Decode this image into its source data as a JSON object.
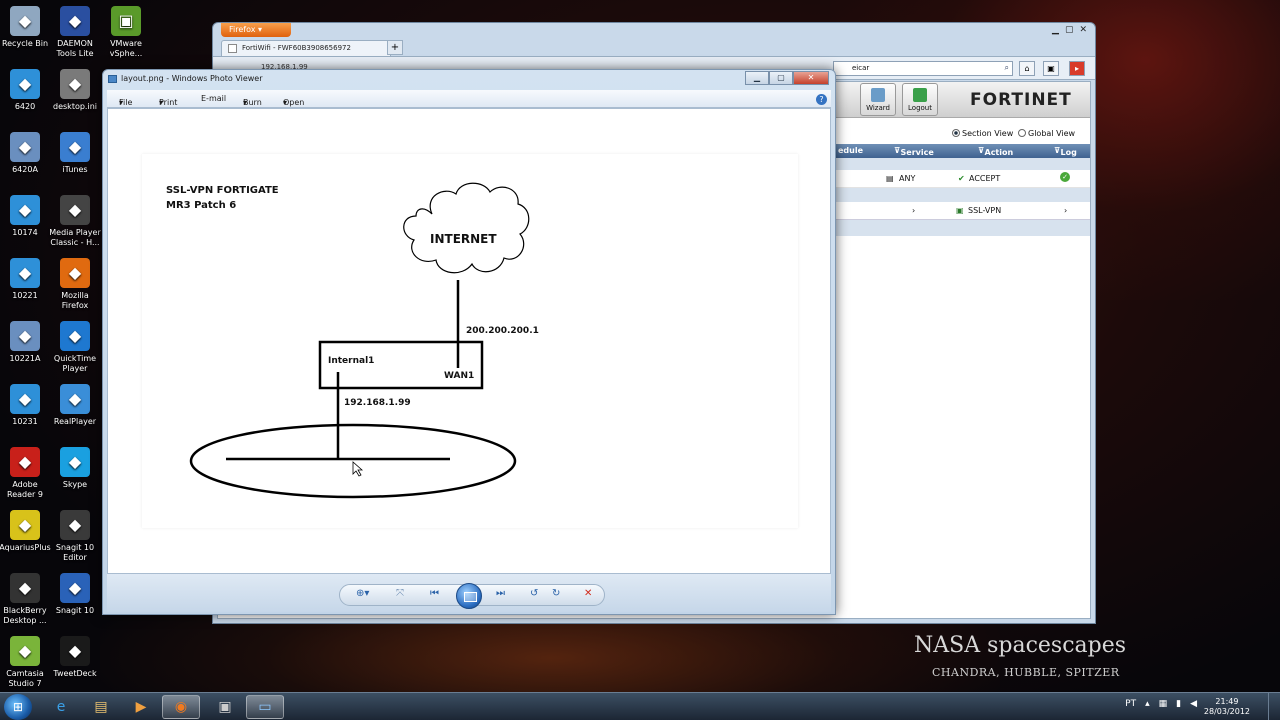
{
  "desktop": {
    "icons_col1": [
      {
        "label": "Recycle Bin",
        "icon": "recycle-bin-icon",
        "color": "#8fa7c0"
      },
      {
        "label": "6420",
        "icon": "vm-icon",
        "color": "#2e90d8"
      },
      {
        "label": "6420A",
        "icon": "vm-icon",
        "color": "#6a8fbf"
      },
      {
        "label": "10174",
        "icon": "vm-icon",
        "color": "#2e90d8"
      },
      {
        "label": "10221",
        "icon": "vm-icon",
        "color": "#2e90d8"
      },
      {
        "label": "10221A",
        "icon": "vm-icon",
        "color": "#6a8fbf"
      },
      {
        "label": "10231",
        "icon": "vm-icon",
        "color": "#2e90d8"
      },
      {
        "label": "Adobe Reader 9",
        "icon": "pdf-icon",
        "color": "#c8201a"
      },
      {
        "label": "AquariusPlus",
        "icon": "aquarius-icon",
        "color": "#d8c21a"
      },
      {
        "label": "BlackBerry Desktop ...",
        "icon": "blackberry-icon",
        "color": "#333333"
      },
      {
        "label": "Camtasia Studio 7",
        "icon": "camtasia-icon",
        "color": "#7ab43a"
      }
    ],
    "icons_col2": [
      {
        "label": "DAEMON Tools Lite",
        "icon": "daemon-tools-icon",
        "color": "#2a4fa0"
      },
      {
        "label": "desktop.ini",
        "icon": "file-icon",
        "color": "#7a7a7a"
      },
      {
        "label": "iTunes",
        "icon": "itunes-icon",
        "color": "#3a7ed0"
      },
      {
        "label": "Media Player Classic - H...",
        "icon": "media-player-icon",
        "color": "#444444"
      },
      {
        "label": "Mozilla Firefox",
        "icon": "firefox-icon",
        "color": "#e06a10"
      },
      {
        "label": "QuickTime Player",
        "icon": "quicktime-icon",
        "color": "#1e78d0"
      },
      {
        "label": "RealPlayer",
        "icon": "realplayer-icon",
        "color": "#3a8ed8"
      },
      {
        "label": "Skype",
        "icon": "skype-icon",
        "color": "#1aa0e0"
      },
      {
        "label": "Snagit 10 Editor",
        "icon": "snagit-editor-icon",
        "color": "#3a3a3a"
      },
      {
        "label": "Snagit 10",
        "icon": "snagit-icon",
        "color": "#2a62b8"
      },
      {
        "label": "TweetDeck",
        "icon": "tweetdeck-icon",
        "color": "#1a1a1a"
      }
    ],
    "icon_col3": {
      "label": "VMware vSphe...",
      "icon": "vmware-icon",
      "color": "#5a9a2a"
    },
    "brand_title": "NASA spacescapes",
    "brand_subtitle": "CHANDRA, HUBBLE, SPITZER"
  },
  "firefox": {
    "menu_label": "Firefox",
    "tab_title": "FortiWifi - FWF60B3908656972",
    "new_tab": "+",
    "url": "192.168.1.99",
    "search_value": "eicar",
    "toolbar_buttons": [
      {
        "label": "Wizard",
        "icon": "wizard-icon"
      },
      {
        "label": "Logout",
        "icon": "logout-icon"
      }
    ],
    "logo": "FORTINET",
    "view_options": [
      "Section View",
      "Global View"
    ],
    "table_headers": [
      "edule",
      "Service",
      "Action",
      "Log"
    ],
    "rows": [
      {
        "service": "ANY",
        "action": "ACCEPT"
      },
      {
        "service": "",
        "action": "SSL-VPN"
      }
    ]
  },
  "photo_viewer": {
    "title": "layout.png - Windows Photo Viewer",
    "menu": [
      "File",
      "Print",
      "E-mail",
      "Burn",
      "Open"
    ],
    "help": "?",
    "diagram": {
      "title_line1": "SSL-VPN FORTIGATE",
      "title_line2": "MR3 Patch 6",
      "cloud_label": "INTERNET",
      "wan_ip": "200.200.200.1",
      "internal_label": "Internal1",
      "wan_label": "WAN1",
      "lan_ip": "192.168.1.99"
    }
  },
  "taskbar": {
    "tray_lang": "PT",
    "time": "21:49",
    "date": "28/03/2012"
  }
}
